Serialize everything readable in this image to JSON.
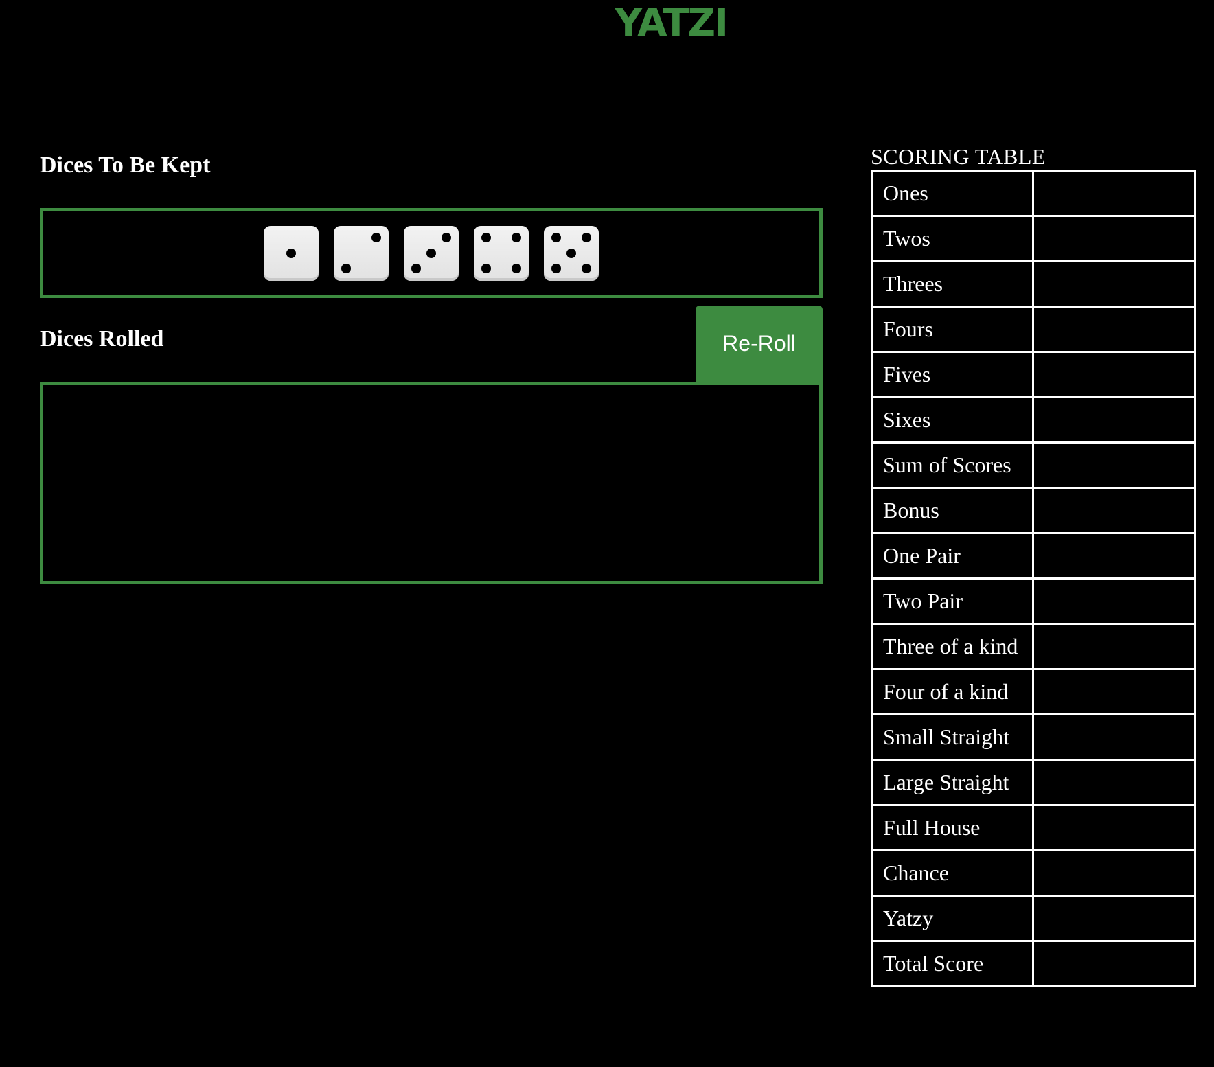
{
  "header": {
    "logo_text": "YATZI",
    "logo_color": "#3d8b40"
  },
  "kept": {
    "heading": "Dices To Be Kept",
    "dice": [
      1,
      2,
      3,
      4,
      5
    ]
  },
  "rolled": {
    "heading": "Dices Rolled",
    "dice": [],
    "reroll_label": "Re-Roll"
  },
  "scoring": {
    "caption": "SCORING TABLE",
    "rows": [
      {
        "label": "Ones",
        "value": ""
      },
      {
        "label": "Twos",
        "value": ""
      },
      {
        "label": "Threes",
        "value": ""
      },
      {
        "label": "Fours",
        "value": ""
      },
      {
        "label": "Fives",
        "value": ""
      },
      {
        "label": "Sixes",
        "value": ""
      },
      {
        "label": "Sum of Scores",
        "value": ""
      },
      {
        "label": "Bonus",
        "value": ""
      },
      {
        "label": "One Pair",
        "value": ""
      },
      {
        "label": "Two Pair",
        "value": ""
      },
      {
        "label": "Three of a kind",
        "value": ""
      },
      {
        "label": "Four of a kind",
        "value": ""
      },
      {
        "label": "Small Straight",
        "value": ""
      },
      {
        "label": "Large Straight",
        "value": ""
      },
      {
        "label": "Full House",
        "value": ""
      },
      {
        "label": "Chance",
        "value": ""
      },
      {
        "label": "Yatzy",
        "value": ""
      },
      {
        "label": "Total Score",
        "value": ""
      }
    ]
  },
  "colors": {
    "accent": "#3d8b40",
    "background": "#000000",
    "die_face": "#eeeeee"
  }
}
